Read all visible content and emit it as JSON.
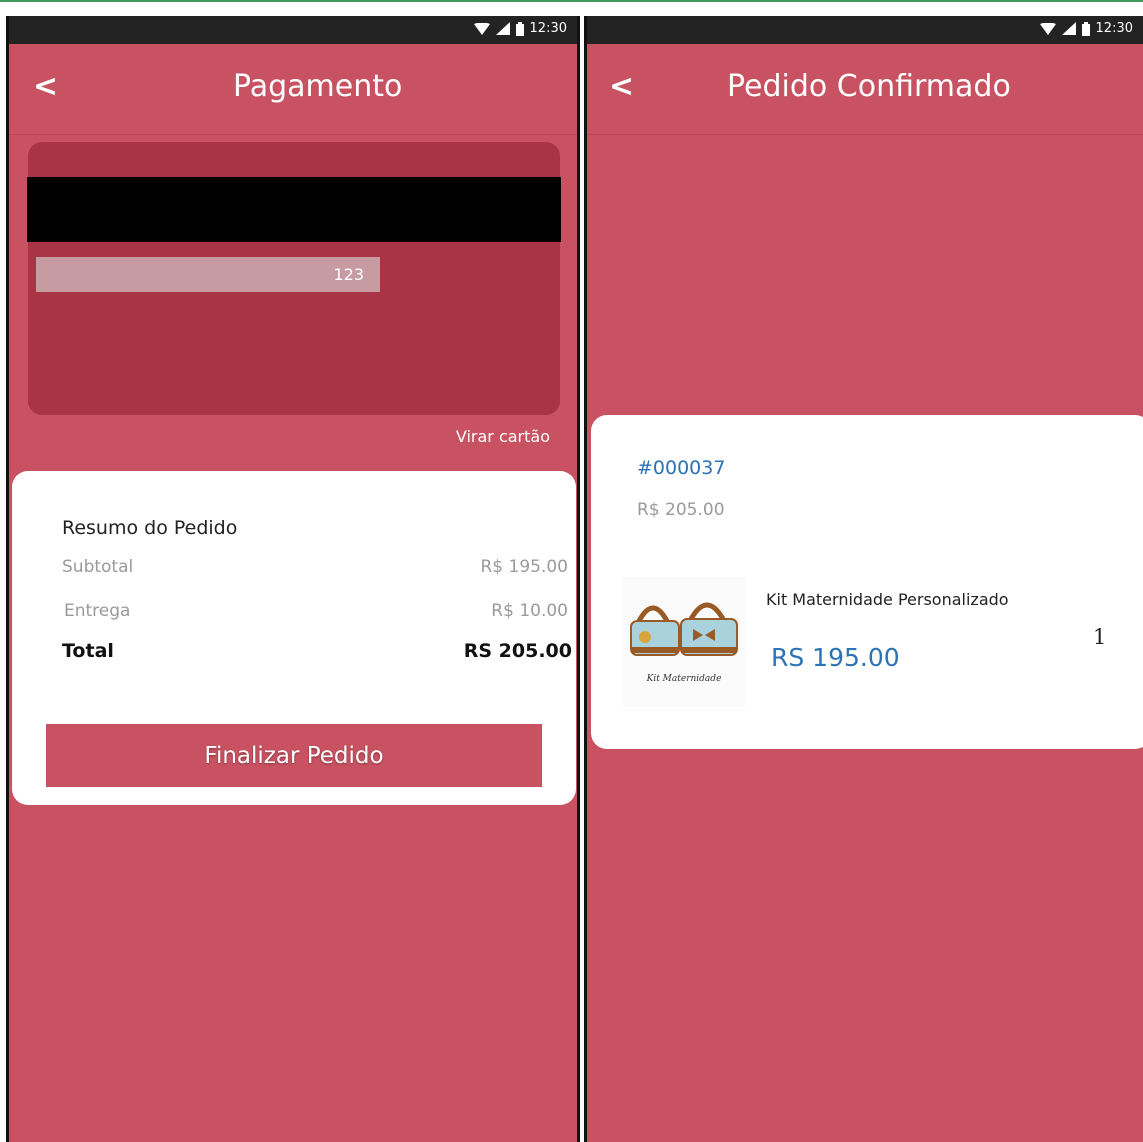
{
  "status_bar": {
    "time": "12:30"
  },
  "payment_screen": {
    "title": "Pagamento",
    "back_label": "<",
    "card": {
      "cvv": "123"
    },
    "flip_card_label": "Virar cartão",
    "summary": {
      "title": "Resumo do Pedido",
      "rows": [
        {
          "label": "Subtotal",
          "value": "R$ 195.00"
        },
        {
          "label": "Entrega",
          "value": "R$ 10.00"
        }
      ],
      "total_label": "Total",
      "total_value": "RS 205.00"
    },
    "finish_button": "Finalizar Pedido"
  },
  "confirmed_screen": {
    "title": "Pedido Confirmado",
    "back_label": "<",
    "order": {
      "number": "#000037",
      "total": "R$ 205.00",
      "item": {
        "name": "Kit Maternidade Personalizado",
        "price": "RS 195.00",
        "quantity": "1",
        "image_caption": "Kit Maternidade"
      }
    }
  },
  "colors": {
    "primary": "#c85262",
    "card": "#a83446",
    "link": "#2b73b5"
  }
}
